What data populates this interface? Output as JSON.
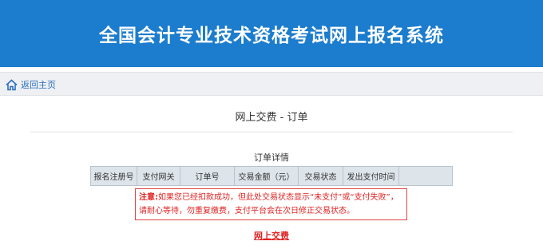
{
  "header": {
    "title": "全国会计专业技术资格考试网上报名系统",
    "bg_color": "#1c7ccd"
  },
  "nav": {
    "back_label": "返回主页",
    "icon": "home-icon"
  },
  "page": {
    "title": "网上交费 - 订单"
  },
  "order": {
    "section_title": "订单详情",
    "columns": [
      "报名注册号",
      "支付网关",
      "订单号",
      "交易金额（元）",
      "交易状态",
      "发出支付时间",
      ""
    ]
  },
  "notice": {
    "label": "注意:",
    "text": "如果您已经扣款成功，但此处交易状态显示“未支付”或“支付失败”，请耐心等待，勿重复缴费，支付平台会在次日修正交易状态。"
  },
  "actions": {
    "pay_label": "网上交费"
  },
  "colors": {
    "accent": "#1c7ccd",
    "warning": "#e02222"
  }
}
